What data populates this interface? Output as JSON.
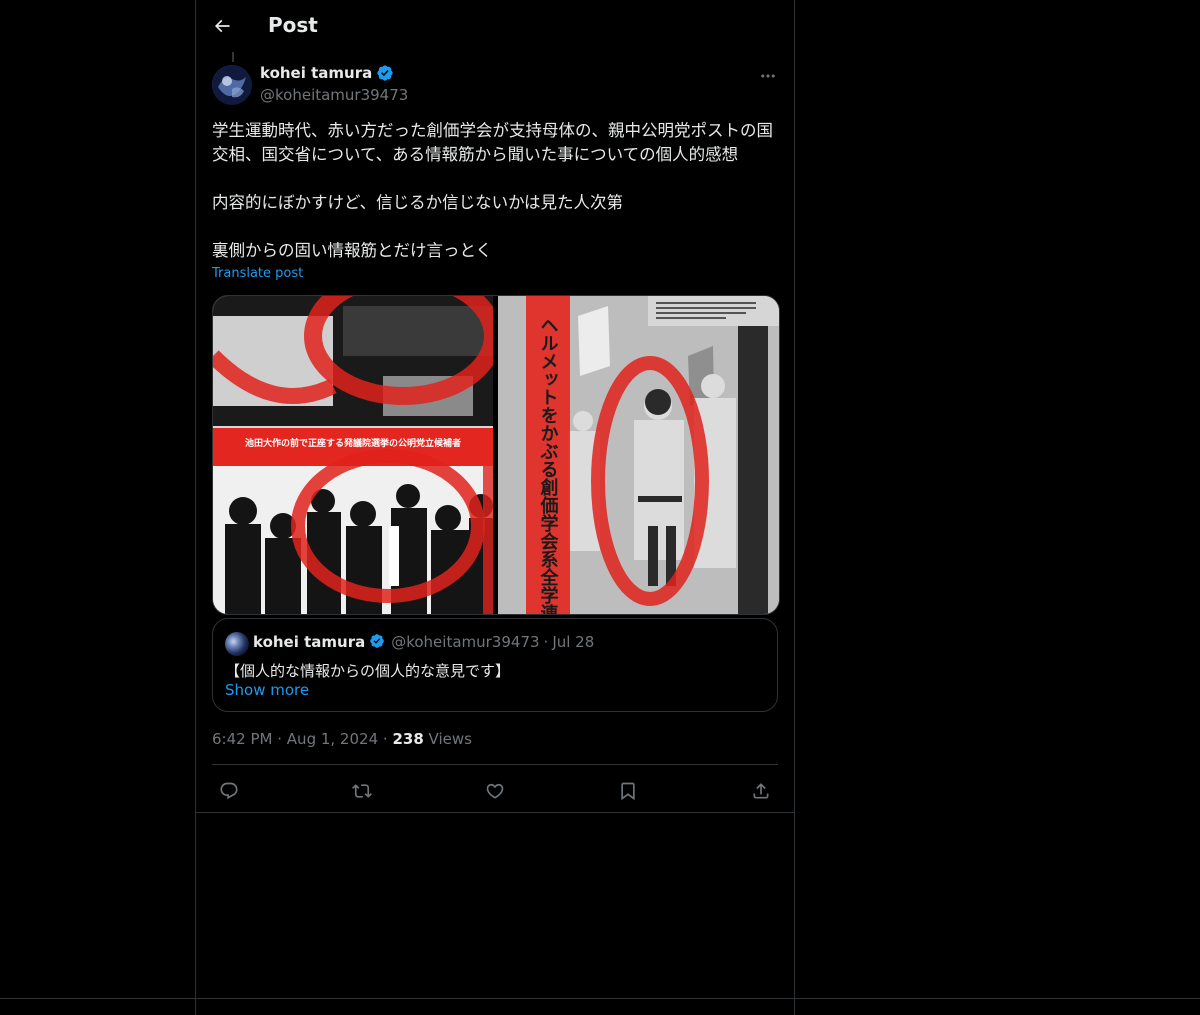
{
  "header": {
    "title": "Post",
    "back_icon": "arrow-left-icon"
  },
  "post": {
    "author": {
      "name": "kohei tamura",
      "handle": "@koheitamur39473",
      "verified": true
    },
    "text": "学生運動時代、赤い方だった創価学会が支持母体の、親中公明党ポストの国交相、国交省について、ある情報筋から聞いた事についての個人的感想\n\n内容的にぼかすけど、信じるか信じないかは見た人次第\n\n裏側からの固い情報筋とだけ言っとく",
    "translate_label": "Translate post",
    "media": {
      "left_image": {
        "caption": "池田大作の前で正座する発議院選挙の公明党立候補者"
      },
      "right_image": {
        "heading": "ヘルメットをかぶる創価学会系全学連"
      }
    },
    "quote": {
      "name": "kohei tamura",
      "handle": "@koheitamur39473",
      "separator": "·",
      "date": "Jul 28",
      "text": "【個人的な情報からの個人的な意見です】",
      "show_more": "Show more"
    },
    "time": "6:42 PM",
    "date": "Aug 1, 2024",
    "views_count": "238",
    "views_label": "Views",
    "separator": "·"
  },
  "actions": [
    {
      "name": "reply-icon"
    },
    {
      "name": "repost-icon"
    },
    {
      "name": "like-icon"
    },
    {
      "name": "bookmark-icon"
    },
    {
      "name": "share-icon"
    }
  ],
  "colors": {
    "background": "#000000",
    "text": "#e7e9ea",
    "secondary": "#71767b",
    "accent": "#1d9bf0",
    "border": "#2f3336"
  }
}
